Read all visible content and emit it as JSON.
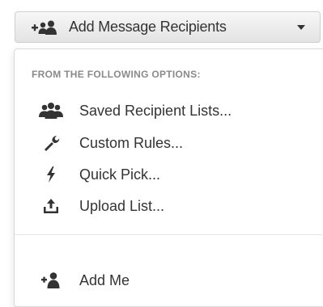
{
  "toggle": {
    "label": "Add Message Recipients",
    "icon": "group-add-icon"
  },
  "menu": {
    "header": "FROM THE FOLLOWING OPTIONS:",
    "items": [
      {
        "label": "Saved Recipient Lists...",
        "icon": "group-icon"
      },
      {
        "label": "Custom Rules...",
        "icon": "wrench-icon"
      },
      {
        "label": "Quick Pick...",
        "icon": "bolt-icon"
      },
      {
        "label": "Upload List...",
        "icon": "upload-icon"
      },
      {
        "label": "Add Me",
        "icon": "user-add-icon"
      }
    ]
  },
  "colors": {
    "text": "#333333",
    "header": "#8a8a8a",
    "button_top": "#f7f7f7",
    "button_bottom": "#e3e3e3"
  }
}
